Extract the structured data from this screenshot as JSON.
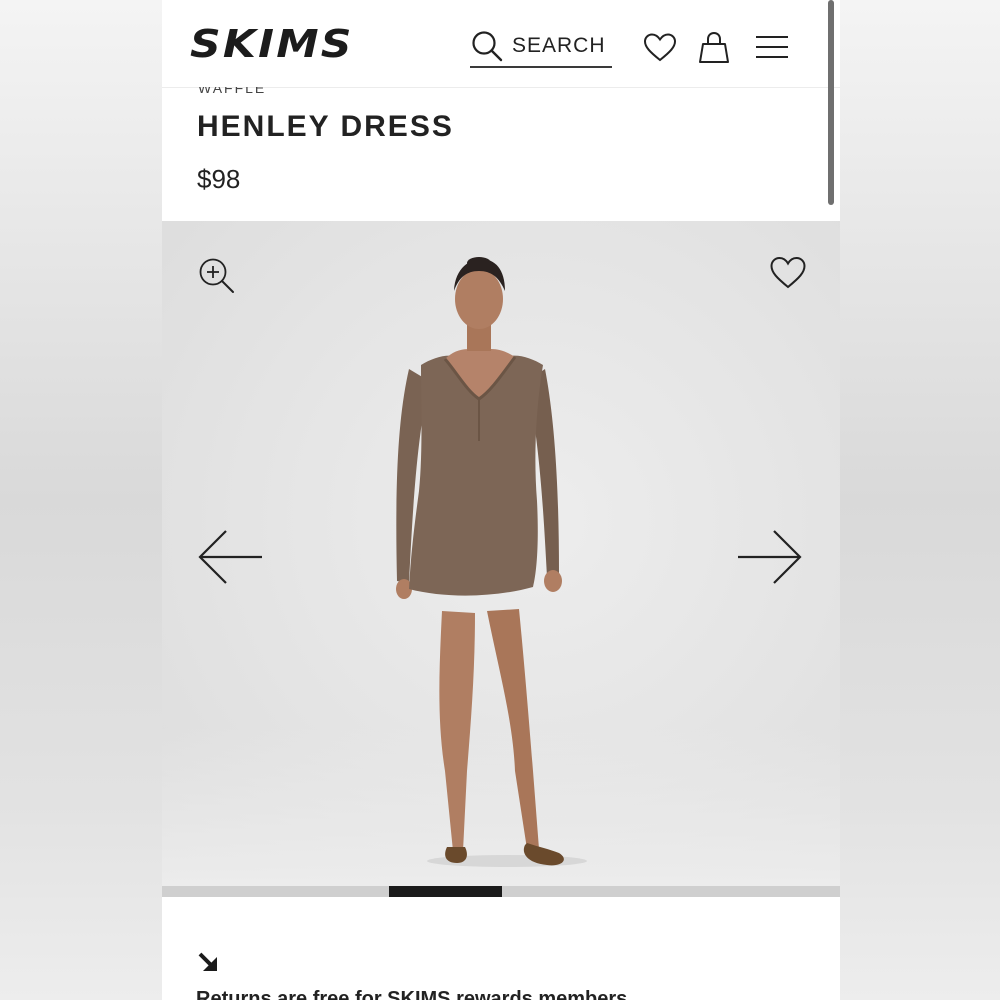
{
  "header": {
    "logo": "SKIMS",
    "search_label": "SEARCH"
  },
  "product": {
    "collection_label": "WAFFLE",
    "title": "HENLEY DRESS",
    "price": "$98"
  },
  "gallery": {
    "image_alt": "Model wearing brown henley dress",
    "progress": {
      "current": 3,
      "total": 6,
      "fraction_start": 0.335,
      "fraction_width": 0.167
    }
  },
  "returns": {
    "text": "Returns are free for SKIMS rewards members"
  },
  "colors": {
    "brand_text": "#1c1c1c",
    "dress": "#7d6656",
    "progress_active": "#1b1b1b",
    "progress_track": "#cfcfcf"
  },
  "icons": [
    "search-icon",
    "heart-icon",
    "bag-icon",
    "menu-icon",
    "zoom-in-icon",
    "arrow-left-icon",
    "arrow-right-icon",
    "arrow-down-right-icon"
  ]
}
